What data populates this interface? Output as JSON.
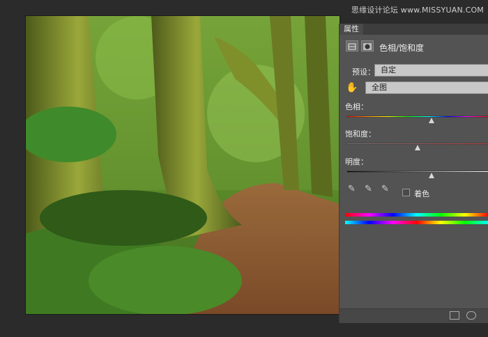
{
  "watermark": "思缘设计论坛 www.MISSYUAN.COM",
  "panel": {
    "tab_label": "属性",
    "adjustment_title": "色相/饱和度",
    "preset_label": "预设：",
    "preset_value": "自定",
    "channel_value": "全图",
    "hue_label": "色相：",
    "saturation_label": "饱和度：",
    "lightness_label": "明度：",
    "colorize_label": "着色",
    "hue_level": 0.6,
    "saturation_level": 0.5,
    "lightness_level": 0.6,
    "colorize_checked": false,
    "colors": {
      "panel_bg": "#535353",
      "saturation_track": "#c24040"
    }
  },
  "icons": [
    "adjustment-layer-icon",
    "mask-icon",
    "hand-icon",
    "eyedropper-icon",
    "eyedropper-plus-icon",
    "eyedropper-minus-icon",
    "clip-to-layer-icon",
    "visibility-icon"
  ]
}
